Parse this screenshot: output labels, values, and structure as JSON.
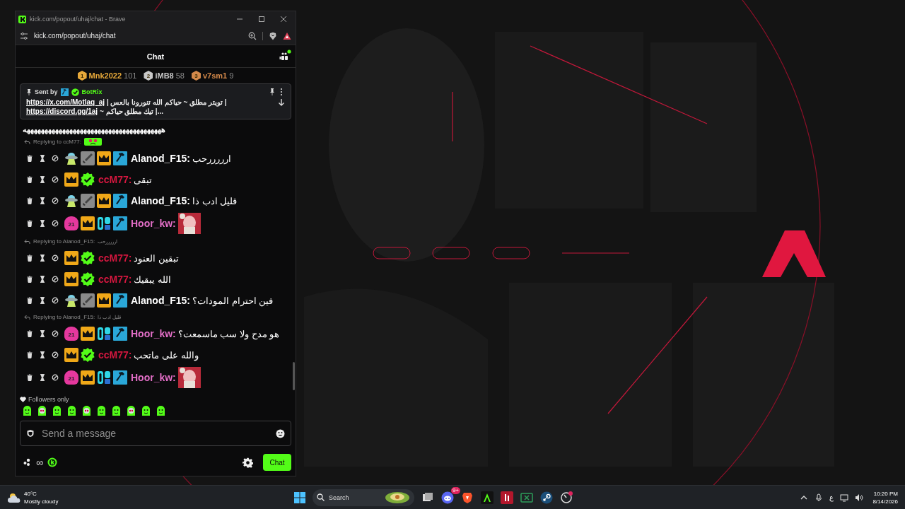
{
  "browser": {
    "title": "kick.com/popout/uhaj/chat - Brave",
    "url": "kick.com/popout/uhaj/chat"
  },
  "chat": {
    "title": "Chat",
    "live": true,
    "leaderboard": [
      {
        "rank": "1",
        "name": "Mnk2022",
        "count": "101",
        "color": "#e8a93a"
      },
      {
        "rank": "2",
        "name": "iMB8",
        "count": "58",
        "color": "#c9c9c9"
      },
      {
        "rank": "3",
        "name": "v7sm1",
        "count": "9",
        "color": "#d4894a"
      }
    ],
    "pinned": {
      "label": "Sent by",
      "sender": "BotRix",
      "lines": [
        {
          "link": "https://x.com/Motlaq_aj",
          "text": " | تويتر مطلق ~ حياكم الله تنورونا بالعس |"
        },
        {
          "link": "https://discord.gg/1aj",
          "text": " ~ تيك مطلق حياكم |..."
        }
      ]
    },
    "messages": [
      {
        "kind": "text",
        "text": "هههههههههههههههههههههههههههههههههههههههه"
      },
      {
        "kind": "reply",
        "to": "Replying to ccM77:"
      },
      {
        "kind": "message",
        "name": "Alanod_F15:",
        "color": "#ffffff",
        "badges": [
          {
            "kind": "ufo"
          },
          {
            "kind": "sword"
          },
          {
            "kind": "crown"
          },
          {
            "kind": "hammer"
          }
        ],
        "text": "ارررررحب"
      },
      {
        "kind": "message",
        "name": "ccM77:",
        "color": "#d5173f",
        "badges": [
          {
            "kind": "crown"
          },
          {
            "kind": "verified"
          }
        ],
        "text": "تبقى"
      },
      {
        "kind": "message",
        "name": "Alanod_F15:",
        "color": "#ffffff",
        "badges": [
          {
            "kind": "ufo"
          },
          {
            "kind": "sword"
          },
          {
            "kind": "crown"
          },
          {
            "kind": "hammer"
          }
        ],
        "text": "قليل ادب ذا"
      },
      {
        "kind": "message",
        "name": "Hoor_kw:",
        "color": "#e46fc8",
        "badges": [
          {
            "kind": "sub",
            "label": "21"
          },
          {
            "kind": "crown"
          },
          {
            "kind": "og"
          },
          {
            "kind": "hammer"
          }
        ]
      },
      {
        "kind": "reply",
        "to": "Replying to Alanod_F15:",
        "quote": "ارررررحب"
      },
      {
        "kind": "message",
        "name": "ccM77:",
        "color": "#d5173f",
        "badges": [
          {
            "kind": "crown"
          },
          {
            "kind": "verified"
          }
        ],
        "text": "تبقين العنود"
      },
      {
        "kind": "message",
        "name": "ccM77:",
        "color": "#d5173f",
        "badges": [
          {
            "kind": "crown"
          },
          {
            "kind": "verified"
          }
        ],
        "text": "الله يبقيك"
      },
      {
        "kind": "message",
        "name": "Alanod_F15:",
        "color": "#ffffff",
        "badges": [
          {
            "kind": "ufo"
          },
          {
            "kind": "sword"
          },
          {
            "kind": "crown"
          },
          {
            "kind": "hammer"
          }
        ],
        "text": "فين احترام المودات؟"
      },
      {
        "kind": "reply",
        "to": "Replying to Alanod_F15:",
        "quote": "قليل ادب ذا"
      },
      {
        "kind": "message",
        "name": "Hoor_kw:",
        "color": "#e46fc8",
        "badges": [
          {
            "kind": "sub",
            "label": "21"
          },
          {
            "kind": "crown"
          },
          {
            "kind": "og"
          },
          {
            "kind": "hammer"
          }
        ],
        "text": "هو مدح ولا سب ماسمعت؟"
      },
      {
        "kind": "message",
        "name": "ccM77:",
        "color": "#d5173f",
        "badges": [
          {
            "kind": "crown"
          },
          {
            "kind": "verified"
          }
        ],
        "text": "والله على ماتحب"
      },
      {
        "kind": "message",
        "name": "Hoor_kw:",
        "color": "#e46fc8",
        "badges": [
          {
            "kind": "sub",
            "label": "21"
          },
          {
            "kind": "crown"
          },
          {
            "kind": "og"
          },
          {
            "kind": "hammer"
          }
        ]
      }
    ],
    "mode": "Followers only",
    "input": {
      "placeholder": "Send a message"
    },
    "infinity": "∞",
    "send_button": "Chat"
  },
  "taskbar": {
    "temperature": "40°C",
    "weather": "Mostly cloudy",
    "search": "Search",
    "discord_badge": "9+",
    "language": "ع",
    "time": "10:20 PM",
    "date": "8/14/2026"
  }
}
